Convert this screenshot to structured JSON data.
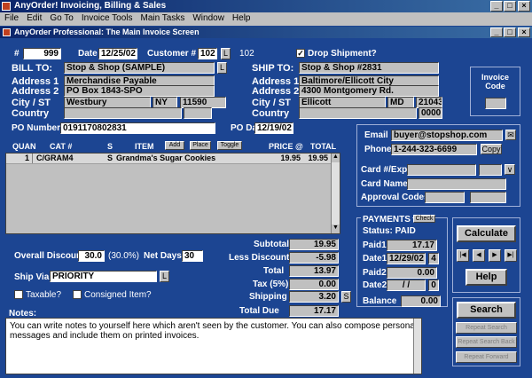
{
  "app": {
    "title": "AnyOrder! Invoicing, Billing & Sales",
    "child_title": "AnyOrder Professional: The Main Invoice Screen"
  },
  "window_buttons": {
    "minimize": "_",
    "maximize": "□",
    "close": "×"
  },
  "menu": [
    "File",
    "Edit",
    "Go To",
    "Invoice Tools",
    "Main Tasks",
    "Window",
    "Help"
  ],
  "header": {
    "number_label": "#",
    "number": "999",
    "date_label": "Date",
    "date": "12/25/02",
    "customer_label": "Customer #",
    "customer": "102",
    "customer_lookup": "L",
    "customer_id_display": "102",
    "drop_shipment_label": "Drop Shipment?",
    "drop_shipment_checked": true
  },
  "bill_to": {
    "label": "BILL TO:",
    "name": "Stop & Shop (SAMPLE)",
    "lookup": "L",
    "address1_label": "Address 1",
    "address1": "Merchandise Payable",
    "address2_label": "Address 2",
    "address2": "PO Box 1843-SPO",
    "city_label": "City / ST",
    "city": "Westbury",
    "state": "NY",
    "zip": "11590",
    "country_label": "Country",
    "country": ""
  },
  "ship_to": {
    "label": "SHIP TO:",
    "name": "Stop & Shop #2831",
    "address1_label": "Address 1",
    "address1": "Baltimore/Ellicott City",
    "address2_label": "Address 2",
    "address2": "4300 Montgomery Rd.",
    "city_label": "City / ST",
    "city": "Ellicott",
    "state": "MD",
    "zip": "21043",
    "country_label": "Country",
    "country": "",
    "zip_ext": "0000"
  },
  "invoice_code": {
    "label": "Invoice Code",
    "value": ""
  },
  "po": {
    "number_label": "PO Number",
    "number": "0191170802831",
    "date_label": "PO Date",
    "date": "12/19/02"
  },
  "items": {
    "headers": {
      "quan": "QUAN",
      "cat": "CAT #",
      "s": "S",
      "item": "ITEM",
      "price": "PRICE @",
      "total": "TOTAL"
    },
    "add": "Add",
    "place": "Place",
    "toggle": "Toggle",
    "rows": [
      {
        "quan": "1",
        "cat": "C/GRAM4",
        "s": "S",
        "item": "Grandma's Sugar Cookies",
        "price": "19.95",
        "total": "19.95",
        "t": "X"
      }
    ]
  },
  "contact": {
    "email_label": "Email",
    "email": "buyer@stopshop.com",
    "phone_label": "Phone",
    "phone": "1-244-323-6699",
    "copy": "Copy",
    "card_label": "Card #/Exp",
    "card_name_label": "Card Name",
    "approval_label": "Approval Codes:"
  },
  "payments": {
    "label": "PAYMENTS",
    "check": "Check",
    "status": "Status: PAID",
    "paid1_label": "Paid1",
    "paid1": "17.17",
    "date1_label": "Date1",
    "date1": "12/29/02",
    "date1_num": "4",
    "paid2_label": "Paid2",
    "paid2": "0.00",
    "date2_label": "Date2",
    "date2": "/ /",
    "date2_num": "0",
    "balance_label": "Balance",
    "balance": "0.00"
  },
  "totals": {
    "overall_discount_label": "Overall Discount",
    "overall_discount": "30.0",
    "overall_discount_pct": "(30.0%)",
    "net_days_label": "Net Days",
    "net_days": "30",
    "ship_via_label": "Ship Via",
    "ship_via": "PRIORITY",
    "ship_lookup": "L",
    "taxable_label": "Taxable?",
    "consigned_label": "Consigned Item?",
    "subtotal_label": "Subtotal",
    "subtotal": "19.95",
    "less_discount_label": "Less Discount",
    "less_discount": "-5.98",
    "total_label": "Total",
    "total": "13.97",
    "tax_label": "Tax (5%)",
    "tax": "0.00",
    "shipping_label": "Shipping",
    "shipping": "3.20",
    "shipping_btn": "S",
    "total_due_label": "Total Due",
    "total_due": "17.17"
  },
  "actions": {
    "calculate": "Calculate",
    "help": "Help",
    "search": "Search",
    "repeat_search": "Repeat Search",
    "repeat_back": "Repeat Search Back",
    "repeat_forward": "Repeat Forward",
    "nav": [
      "|◀",
      "◀",
      "▶",
      "▶|"
    ]
  },
  "notes": {
    "label": "Notes:",
    "text": "You can write notes to yourself here which aren't seen by the customer.  You can also compose personal messages and include them on printed invoices."
  },
  "watermark": "GearDownload.com"
}
